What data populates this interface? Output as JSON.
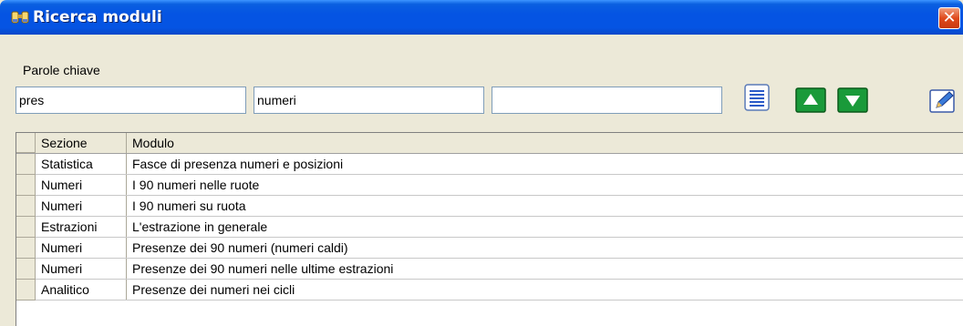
{
  "window": {
    "title": "Ricerca moduli",
    "close_glyph": "✕"
  },
  "search": {
    "label": "Parole chiave",
    "fields": [
      "pres",
      "numeri",
      ""
    ]
  },
  "toolbar": {
    "icons": [
      "list-icon",
      "arrow-up-icon",
      "arrow-down-icon",
      "edit-icon"
    ]
  },
  "table": {
    "columns": [
      "Sezione",
      "Modulo"
    ],
    "rows": [
      {
        "sezione": "Statistica",
        "modulo": "Fasce di presenza numeri e posizioni"
      },
      {
        "sezione": "Numeri",
        "modulo": "I 90 numeri nelle ruote"
      },
      {
        "sezione": "Numeri",
        "modulo": "I 90 numeri su ruota"
      },
      {
        "sezione": "Estrazioni",
        "modulo": "L'estrazione in generale"
      },
      {
        "sezione": "Numeri",
        "modulo": "Presenze dei 90 numeri (numeri caldi)"
      },
      {
        "sezione": "Numeri",
        "modulo": "Presenze dei 90 numeri nelle ultime estrazioni"
      },
      {
        "sezione": "Analitico",
        "modulo": "Presenze dei numeri nei cicli"
      }
    ]
  },
  "colors": {
    "titlebar": "#0554e3",
    "close": "#e04a1c",
    "arrow_button": "#1a9a3a"
  }
}
